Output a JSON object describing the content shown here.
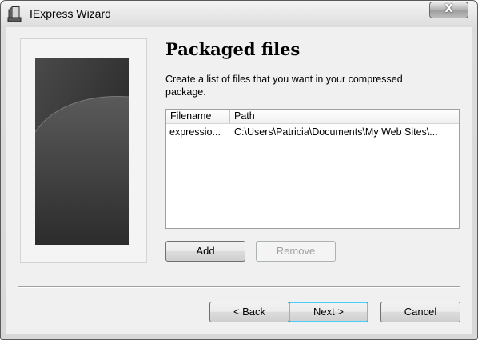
{
  "window": {
    "title": "IExpress Wizard",
    "app_icon": "iexpress-app-icon",
    "close_glyph": "X",
    "close_icon": "close-icon"
  },
  "page": {
    "heading": "Packaged files",
    "description": "Create a list of files that you want in your compressed package."
  },
  "file_list": {
    "columns": [
      "Filename",
      "Path"
    ],
    "rows": [
      {
        "filename": "expressio...",
        "path": "C:\\Users\\Patricia\\Documents\\My Web Sites\\..."
      }
    ]
  },
  "list_buttons": {
    "add": "Add",
    "remove": "Remove",
    "remove_disabled": true
  },
  "nav_buttons": {
    "back": "< Back",
    "next": "Next >",
    "cancel": "Cancel",
    "default": "next"
  },
  "colors": {
    "accent_focus": "#3c7fb1",
    "side_image": "#2a2a2a"
  }
}
